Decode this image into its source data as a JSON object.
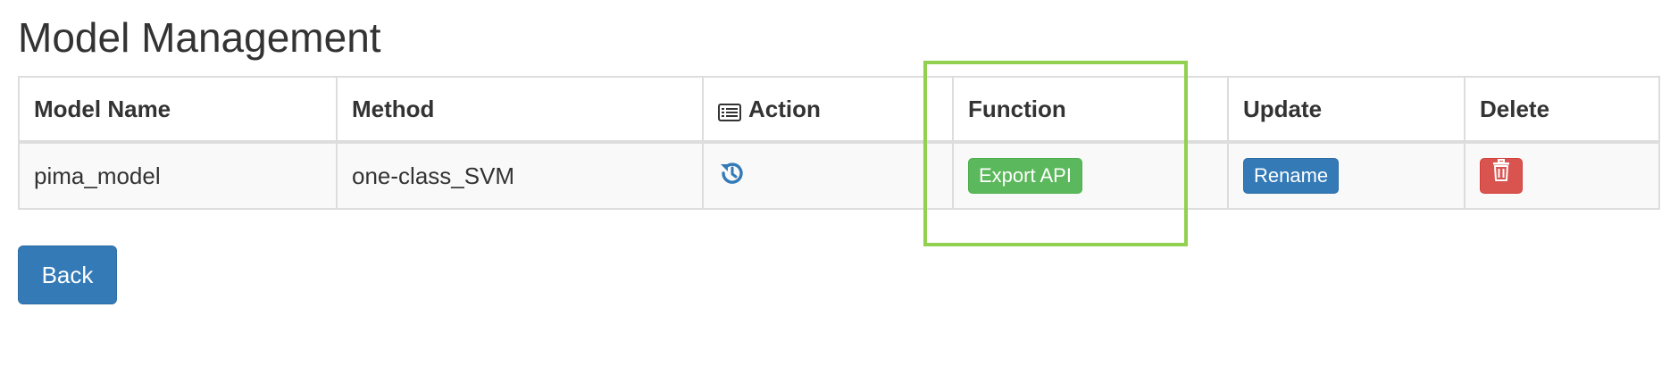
{
  "page": {
    "title": "Model Management"
  },
  "table": {
    "headers": {
      "model_name": "Model Name",
      "method": "Method",
      "action": "Action",
      "function": "Function",
      "update": "Update",
      "delete": "Delete"
    },
    "action_header_icon": "list-alt-icon",
    "rows": [
      {
        "model_name": "pima_model",
        "method": "one-class_SVM",
        "action_icon": "history-icon",
        "function_button": "Export API",
        "update_button": "Rename",
        "delete_icon": "trash-icon"
      }
    ]
  },
  "footer": {
    "back_label": "Back"
  },
  "colors": {
    "highlight": "#92d050",
    "success": "#5cb85c",
    "primary": "#337ab7",
    "danger": "#d9534f",
    "icon_blue": "#337ab7"
  }
}
